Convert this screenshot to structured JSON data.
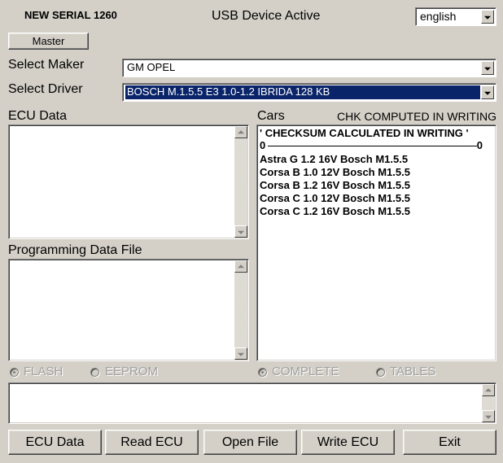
{
  "header": {
    "serial": "NEW SERIAL 1260",
    "status": "USB Device Active",
    "language": "english"
  },
  "master_button": "Master",
  "maker": {
    "label": "Select Maker",
    "value": "GM OPEL"
  },
  "driver": {
    "label": "Select Driver",
    "value": "BOSCH M.1.5.5 E3  1.0-1.2 IBRIDA 128 KB"
  },
  "ecu_data": {
    "label": "ECU Data"
  },
  "programming_file": {
    "label": "Programming Data File"
  },
  "cars": {
    "label": "Cars",
    "checksum_status": "CHK COMPUTED IN WRITING",
    "header_line": "' CHECKSUM CALCULATED IN WRITING '",
    "range_start": "0",
    "range_end": "0",
    "items": [
      "Astra G 1.2 16V Bosch M1.5.5",
      "Corsa B 1.0 12V Bosch M1.5.5",
      "Corsa B 1.2 16V Bosch M1.5.5",
      "Corsa C 1.0 12V Bosch M1.5.5",
      "Corsa C 1.2 16V Bosch M1.5.5"
    ]
  },
  "memory_type": {
    "options": [
      "FLASH",
      "EEPROM"
    ],
    "selected": "FLASH"
  },
  "write_mode": {
    "options": [
      "COMPLETE",
      "TABLES"
    ],
    "selected": "COMPLETE"
  },
  "buttons": {
    "ecu_data": "ECU Data",
    "read_ecu": "Read ECU",
    "open_file": "Open File",
    "write_ecu": "Write ECU",
    "exit": "Exit"
  },
  "colors": {
    "window_bg": "#d4d0c8",
    "selection_bg": "#0a246a",
    "disabled_text": "#a0a0a0"
  }
}
